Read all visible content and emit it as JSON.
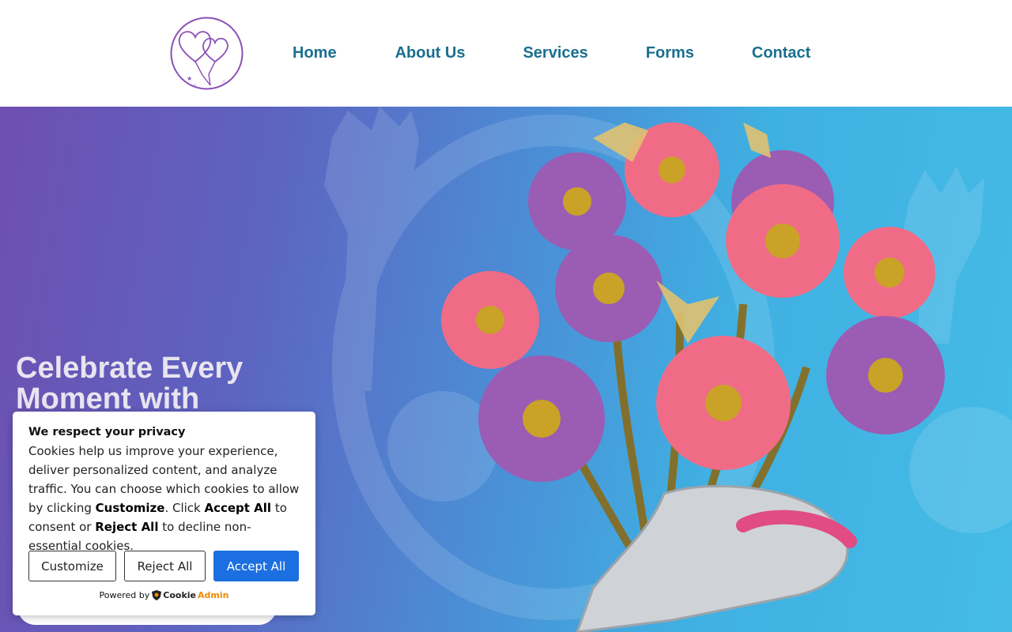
{
  "header": {
    "logo_icon": "heart-balloons-logo",
    "nav": [
      {
        "label": "Home"
      },
      {
        "label": "About Us"
      },
      {
        "label": "Services"
      },
      {
        "label": "Forms"
      },
      {
        "label": "Contact"
      }
    ]
  },
  "hero": {
    "title": "Celebrate Every Moment with"
  },
  "cookie_banner": {
    "title": "We respect your privacy",
    "text_1": "Cookies help us improve your experience, deliver personalized content, and analyze traffic. You can choose which cookies to allow by clicking ",
    "bold_customize": "Customize",
    "text_2": ". Click ",
    "bold_accept": "Accept All",
    "text_3": " to consent or ",
    "bold_reject": "Reject All",
    "text_4": " to decline non-essential cookies.",
    "customize_label": "Customize",
    "reject_label": "Reject All",
    "accept_label": "Accept All",
    "powered_by": "Powered by",
    "brand_cookie": "Cookie",
    "brand_admin": "Admin"
  },
  "colors": {
    "nav_text": "#1a6f8f",
    "logo_purple": "#8a4fb5",
    "accept_button": "#1c6fe0",
    "balloon_pink": "#f06c86",
    "balloon_purple": "#9b5cb4",
    "balloon_gold": "#c9a227"
  }
}
